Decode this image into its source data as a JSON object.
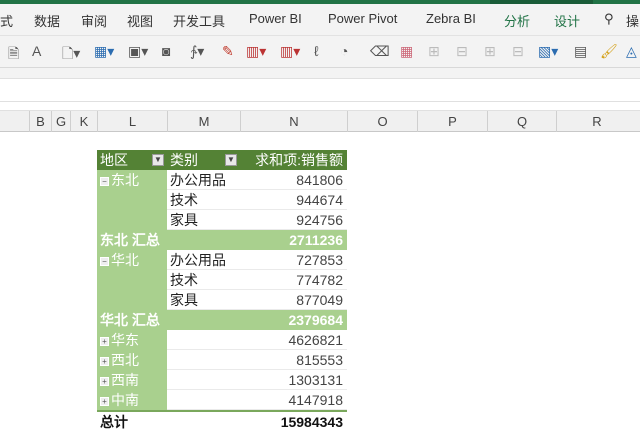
{
  "ribbon_tabs": [
    {
      "label": "式"
    },
    {
      "label": "数据"
    },
    {
      "label": "审阅"
    },
    {
      "label": "视图"
    },
    {
      "label": "开发工具"
    },
    {
      "label": "Power BI"
    },
    {
      "label": "Power Pivot"
    },
    {
      "label": "Zebra BI"
    },
    {
      "label": "分析"
    },
    {
      "label": "设计"
    }
  ],
  "search_label": "操",
  "columns": [
    "B",
    "G",
    "K",
    "L",
    "M",
    "N",
    "O",
    "P",
    "Q",
    "R"
  ],
  "pivot": {
    "headers": {
      "region": "地区",
      "category": "类别",
      "value": "求和项:销售额"
    },
    "groups": [
      {
        "region": "东北",
        "items": [
          {
            "category": "办公用品",
            "value": "841806"
          },
          {
            "category": "技术",
            "value": "944674"
          },
          {
            "category": "家具",
            "value": "924756"
          }
        ],
        "subtotal_label": "东北 汇总",
        "subtotal": "2711236"
      },
      {
        "region": "华北",
        "items": [
          {
            "category": "办公用品",
            "value": "727853"
          },
          {
            "category": "技术",
            "value": "774782"
          },
          {
            "category": "家具",
            "value": "877049"
          }
        ],
        "subtotal_label": "华北 汇总",
        "subtotal": "2379684"
      }
    ],
    "collapsed": [
      {
        "region": "华东",
        "value": "4626821"
      },
      {
        "region": "西北",
        "value": "815553"
      },
      {
        "region": "西南",
        "value": "1303131"
      },
      {
        "region": "中南",
        "value": "4147918"
      }
    ],
    "total_label": "总计",
    "total": "15984343"
  }
}
